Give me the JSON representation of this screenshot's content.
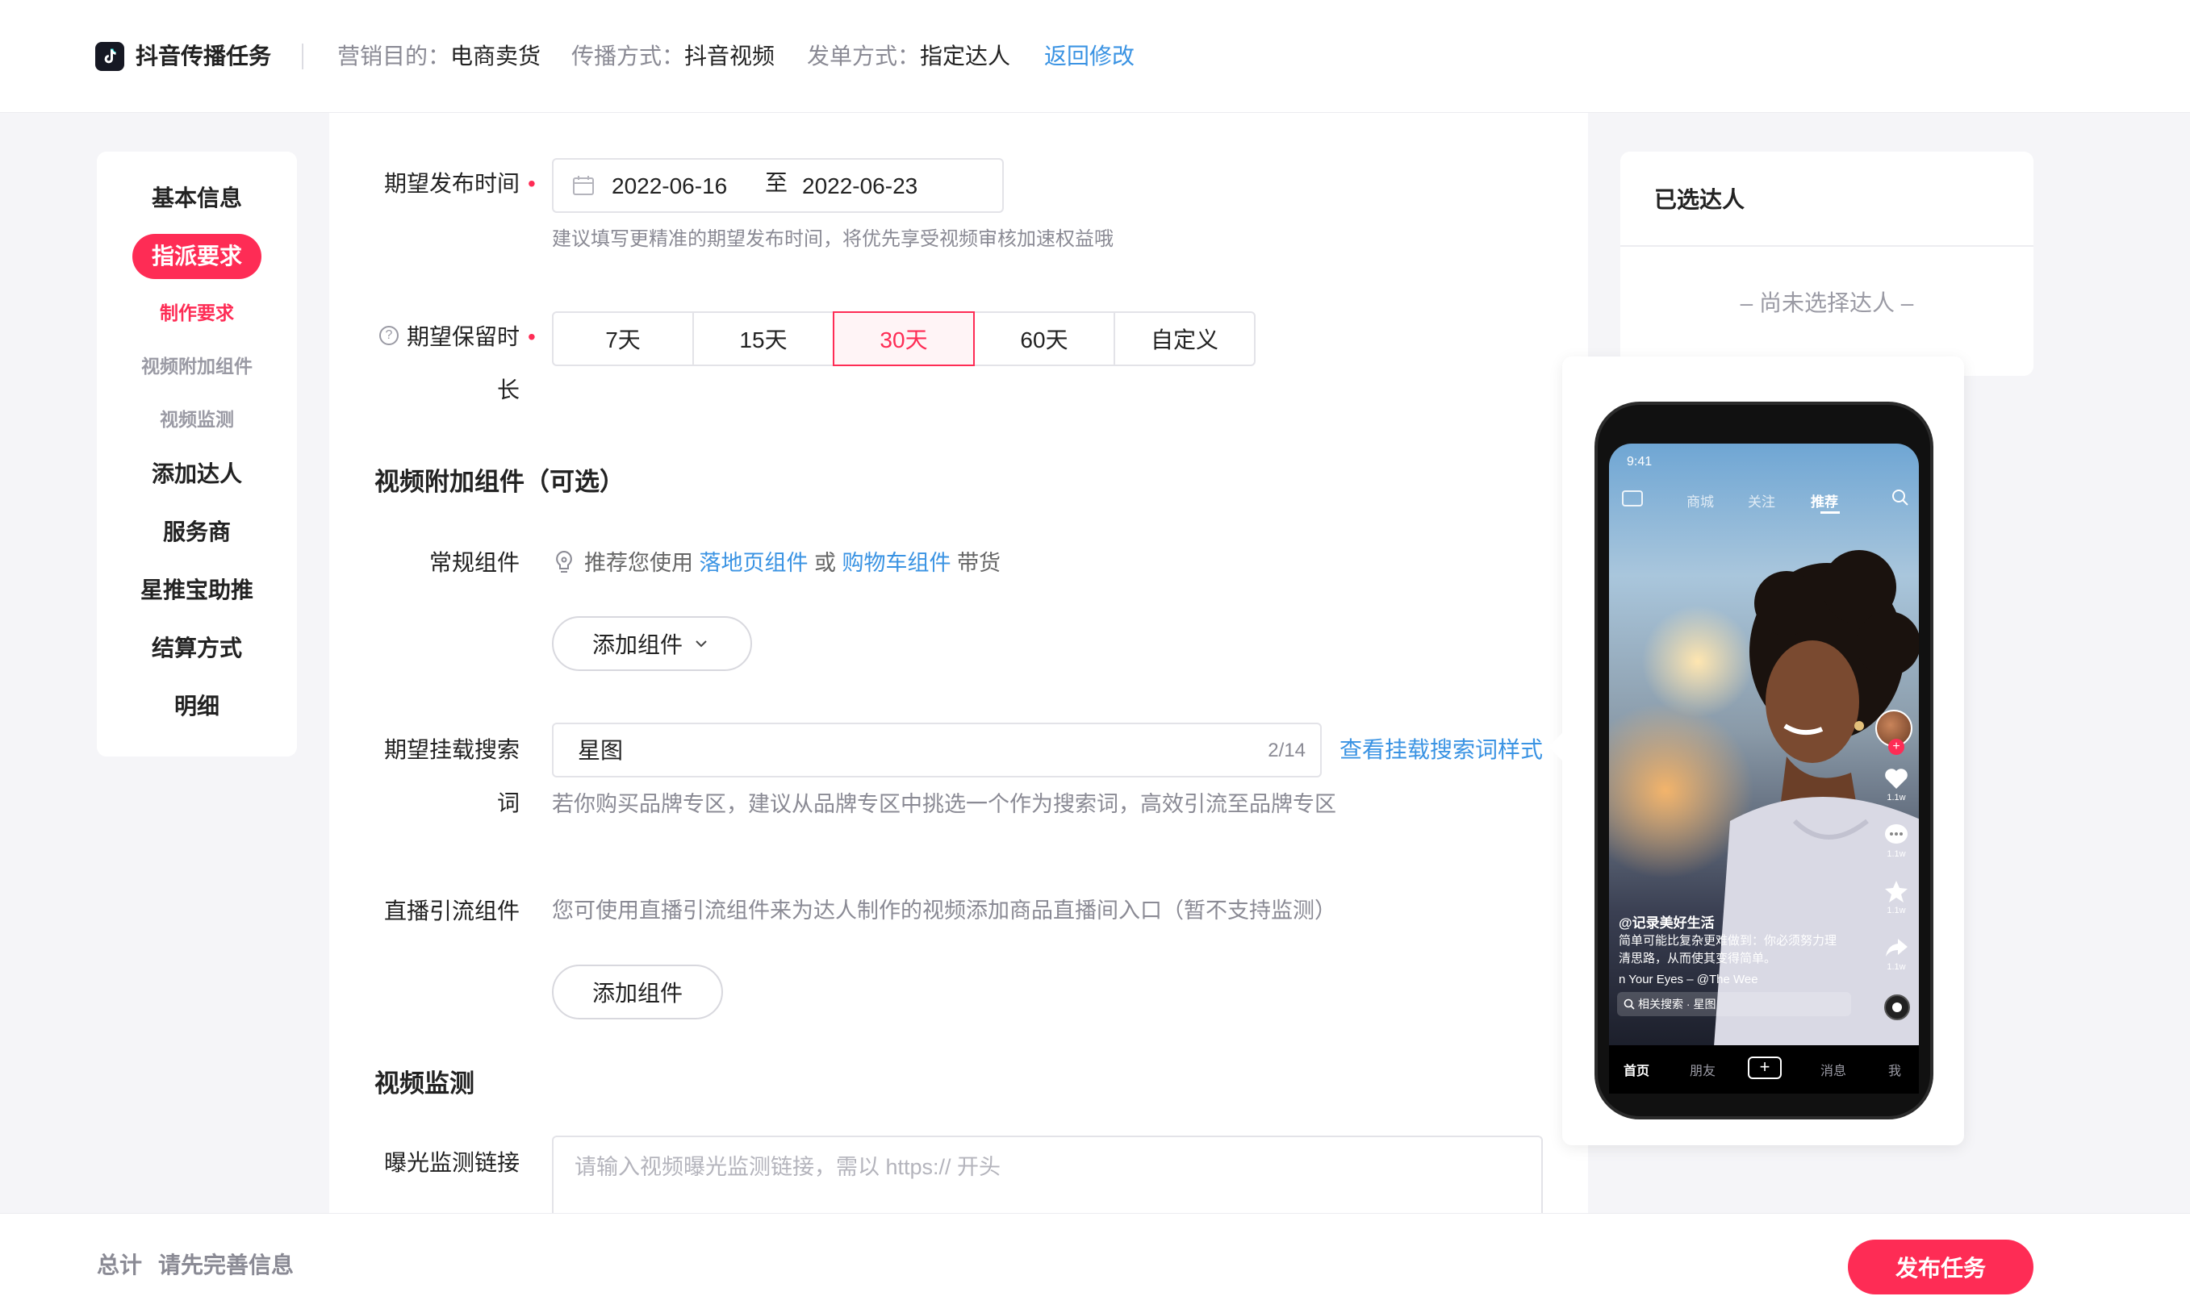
{
  "header": {
    "title": "抖音传播任务",
    "meta": [
      {
        "key": "营销目的：",
        "value": "电商卖货"
      },
      {
        "key": "传播方式：",
        "value": "抖音视频"
      },
      {
        "key": "发单方式：",
        "value": "指定达人"
      }
    ],
    "back_link": "返回修改"
  },
  "left_nav": {
    "basic": "基本信息",
    "assign": "指派要求",
    "subs": [
      "制作要求",
      "视频附加组件",
      "视频监测"
    ],
    "items": [
      "添加达人",
      "服务商",
      "星推宝助推",
      "结算方式",
      "明细"
    ]
  },
  "form": {
    "publish_time": {
      "label": "期望发布时间",
      "required_mark": "•",
      "start": "2022-06-16",
      "separator": "至",
      "end": "2022-06-23",
      "hint": "建议填写更精准的期望发布时间，将优先享受视频审核加速权益哦"
    },
    "retention": {
      "label_line1": "期望保留时",
      "label_line2": "长",
      "required_mark": "•",
      "options": [
        "7天",
        "15天",
        "30天",
        "60天",
        "自定义"
      ],
      "selected": "30天"
    },
    "addon_section_title": "视频附加组件（可选）",
    "regular": {
      "label": "常规组件",
      "tip_prefix": "推荐您使用",
      "link1": "落地页组件",
      "or": "或",
      "link2": "购物车组件",
      "suffix": "带货",
      "add_button": "添加组件"
    },
    "search_word": {
      "label_line1": "期望挂载搜索",
      "label_line2": "词",
      "value": "星图",
      "count": "2/14",
      "view_link": "查看挂载搜索词样式",
      "hint": "若你购买品牌专区，建议从品牌专区中挑选一个作为搜索词，高效引流至品牌专区"
    },
    "live": {
      "label": "直播引流组件",
      "hint": "您可使用直播引流组件来为达人制作的视频添加商品直播间入口（暂不支持监测）",
      "add_button": "添加组件"
    },
    "monitor_section_title": "视频监测",
    "exposure": {
      "label": "曝光监测链接",
      "placeholder": "请输入视频曝光监测链接，需以 https:// 开头"
    }
  },
  "selected_panel": {
    "title": "已选达人",
    "empty": "– 尚未选择达人 –"
  },
  "phone_preview": {
    "time": "9:41",
    "top_tabs": [
      "商城",
      "关注",
      "推荐"
    ],
    "active_top_tab": "推荐",
    "like_count": "1.1w",
    "comment_count": "1.1w",
    "fav_count": "1.1w",
    "share_count": "1.1w",
    "username": "@记录美好生活",
    "caption": "简单可能比复杂更难做到：你必须努力理清思路，从而使其变得简单。",
    "music": "n Your Eyes – @The Wee",
    "related_search": "相关搜索 · 星图",
    "bottom_tabs": [
      "首页",
      "朋友",
      "消息",
      "我"
    ]
  },
  "footer": {
    "total_label": "总计",
    "total_msg": "请先完善信息",
    "publish_button": "发布任务"
  },
  "colors": {
    "accent": "#fe2c55",
    "link": "#3a93e3",
    "muted": "#8a8a94",
    "page_bg": "#f5f5f8"
  }
}
